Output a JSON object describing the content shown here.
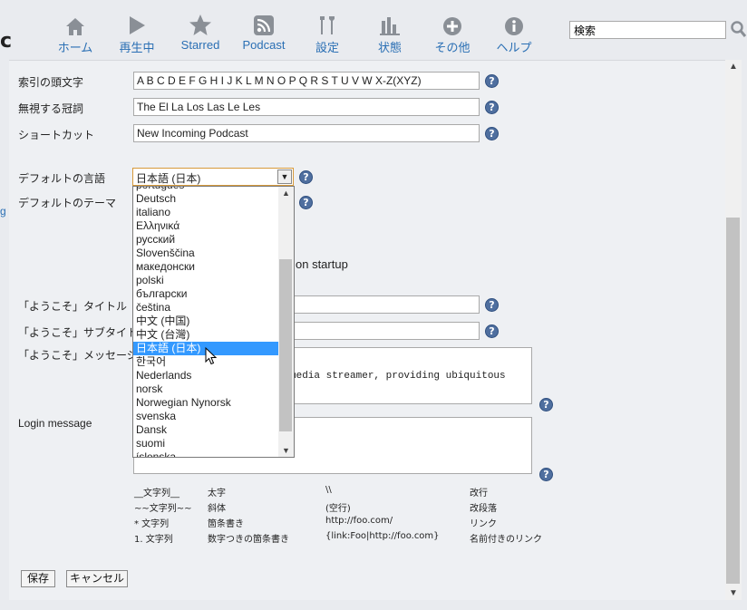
{
  "nav": {
    "logo_fragment": "c",
    "items": [
      {
        "label": "ホーム",
        "icon": "home-icon"
      },
      {
        "label": "再生中",
        "icon": "play-icon"
      },
      {
        "label": "Starred",
        "icon": "star-icon"
      },
      {
        "label": "Podcast",
        "icon": "podcast-icon"
      },
      {
        "label": "設定",
        "icon": "settings-tools-icon"
      },
      {
        "label": "状態",
        "icon": "bar-chart-icon"
      },
      {
        "label": "その他",
        "icon": "plus-circle-icon"
      },
      {
        "label": "ヘルプ",
        "icon": "info-icon"
      }
    ],
    "search_value": "検索"
  },
  "form": {
    "index_label": "索引の頭文字",
    "index_value": "A B C D E F G H I J K L M N O P Q R S T U V W X-Z(XYZ)",
    "ignore_label": "無視する冠詞",
    "ignore_value": "The El La Los Las Le Les",
    "shortcut_label": "ショートカット",
    "shortcut_value": "New Incoming Podcast",
    "language_label": "デフォルトの言語",
    "language_value": "日本語 (日本)",
    "theme_label": "デフォルトのテーマ",
    "startup_fragment": "on startup",
    "welcome_title_label": "「ようこそ」タイトル",
    "welcome_subtitle_label": "「ようこそ」サブタイトル",
    "welcome_message_label": "「ようこそ」メッセージ",
    "welcome_message_value": "media streamer, providing ubiquitous",
    "login_message_label": "Login message",
    "left_fragment": "g"
  },
  "language_options": [
    "português",
    "Deutsch",
    "italiano",
    "Ελληνικά",
    "русский",
    "Slovenščina",
    "македонски",
    "polski",
    "български",
    "čeština",
    "中文 (中国)",
    "中文 (台灣)",
    "日本語 (日本)",
    "한국어",
    "Nederlands",
    "norsk",
    "Norwegian Nynorsk",
    "svenska",
    "Dansk",
    "suomi",
    "íslenska"
  ],
  "markup_help": [
    [
      "__文字列__",
      "太字",
      "\\\\",
      "改行"
    ],
    [
      "~~文字列~~",
      "斜体",
      "(空行)",
      "改段落"
    ],
    [
      "* 文字列",
      "箇条書き",
      "http://foo.com/",
      "リンク"
    ],
    [
      "1. 文字列",
      "数字つきの箇条書き",
      "{link:Foo|http://foo.com}",
      "名前付きのリンク"
    ]
  ],
  "buttons": {
    "save": "保存",
    "cancel": "キャンセル"
  },
  "colors": {
    "accent": "#2a6fb4",
    "selected": "#3399ff",
    "help_icon": "#4f6f9f"
  }
}
